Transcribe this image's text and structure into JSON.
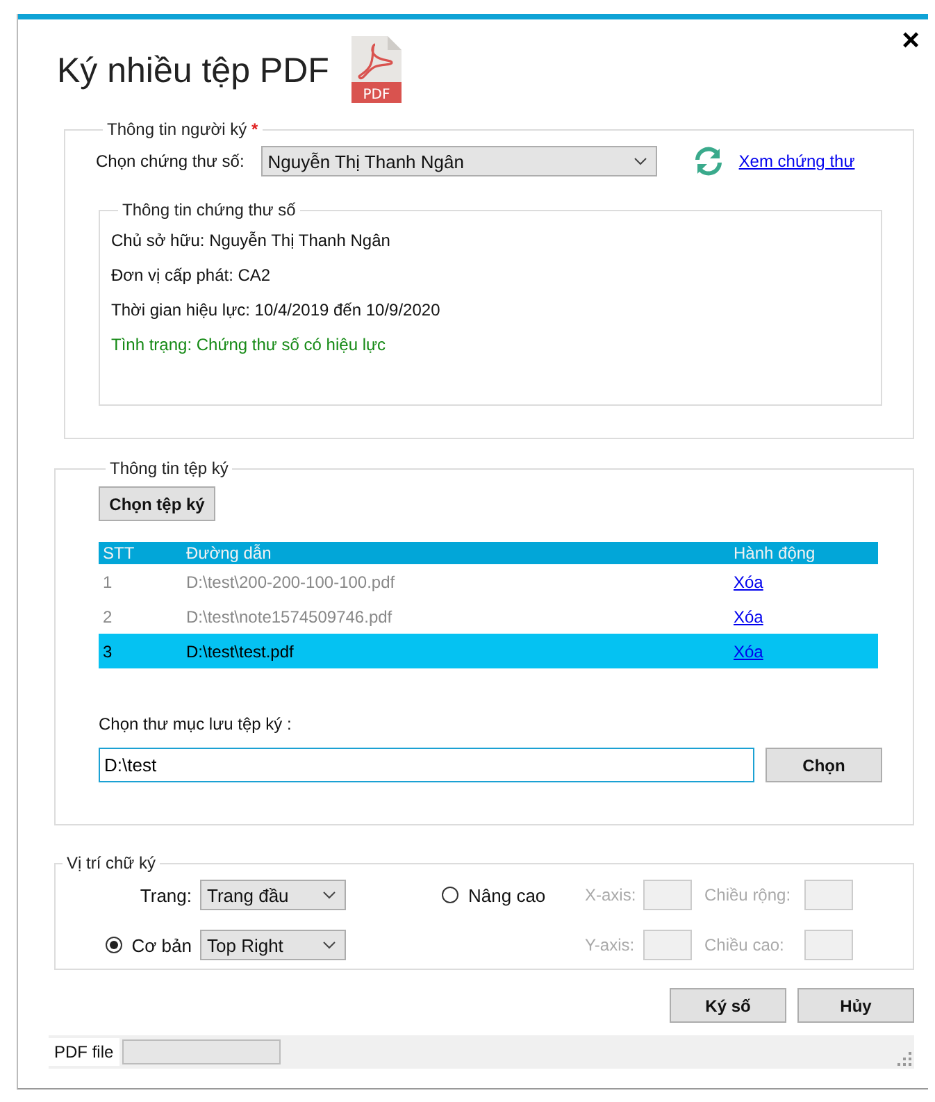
{
  "window": {
    "title": "Ký nhiều tệp PDF",
    "icon_label": "PDF",
    "close": "×"
  },
  "signer": {
    "legend": "Thông tin người ký",
    "required_mark": "*",
    "cert_label": "Chọn chứng thư số:",
    "cert_value": "Nguyễn Thị Thanh Ngân",
    "view_link": "Xem chứng thư",
    "cert_info": {
      "legend": "Thông tin chứng thư số",
      "lines": [
        {
          "text": "Chủ sở hữu: Nguyễn Thị Thanh Ngân",
          "kind": "normal"
        },
        {
          "text": "Đơn vị cấp phát: CA2",
          "kind": "normal"
        },
        {
          "text": "Thời gian hiệu lực: 10/4/2019 đến 10/9/2020",
          "kind": "normal"
        },
        {
          "text": "Tình trạng: Chứng thư số có hiệu lực",
          "kind": "status"
        }
      ]
    }
  },
  "files": {
    "legend": "Thông tin tệp ký",
    "choose_button": "Chọn tệp ký",
    "columns": [
      "STT",
      "Đường dẫn",
      "Hành động"
    ],
    "rows": [
      {
        "stt": "1",
        "path": "D:\\test\\200-200-100-100.pdf",
        "action": "Xóa",
        "selected": false
      },
      {
        "stt": "2",
        "path": "D:\\test\\note1574509746.pdf",
        "action": "Xóa",
        "selected": false
      },
      {
        "stt": "3",
        "path": "D:\\test\\test.pdf",
        "action": "Xóa",
        "selected": true
      }
    ],
    "folder_label": "Chọn thư mục lưu tệp ký :",
    "folder_value": "D:\\test",
    "folder_button": "Chọn"
  },
  "position": {
    "legend": "Vị trí chữ ký",
    "page_label": "Trang:",
    "page_value": "Trang đầu",
    "basic": {
      "label": "Cơ bản",
      "selected": true,
      "value": "Top Right"
    },
    "advanced": {
      "label": "Nâng cao",
      "selected": false
    },
    "fields": [
      {
        "label": "X-axis:",
        "disabled": true
      },
      {
        "label": "Chiều rộng:",
        "disabled": true
      },
      {
        "label": "Y-axis:",
        "disabled": true
      },
      {
        "label": "Chiều cao:",
        "disabled": true
      }
    ]
  },
  "buttons": [
    {
      "label": "Ký số"
    },
    {
      "label": "Hủy"
    }
  ],
  "status_bar": {
    "label": "PDF file",
    "level": 0
  }
}
